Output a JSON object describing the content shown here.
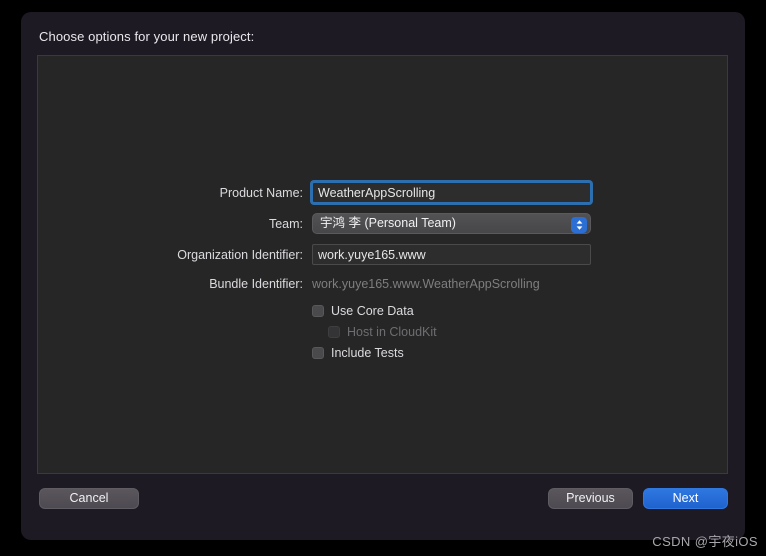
{
  "dialog": {
    "title": "Choose options for your new project:"
  },
  "form": {
    "rows": [
      {
        "label": "Product Name:",
        "value": "WeatherAppScrolling",
        "placeholder": "Product Name",
        "type": "textfield",
        "focused": true
      },
      {
        "label": "Team:",
        "value": "宇鸿 李 (Personal Team)",
        "type": "popup",
        "stepper_icon": "up-down-chevron-icon"
      },
      {
        "label": "Organization Identifier:",
        "value": "work.yuye165.www",
        "placeholder": "Organization Identifier",
        "type": "textfield",
        "focused": false
      },
      {
        "label": "Bundle Identifier:",
        "value": "work.yuye165.www.WeatherAppScrolling",
        "type": "static"
      }
    ],
    "checkboxes": [
      {
        "label": "Use Core Data",
        "checked": false,
        "disabled": false
      },
      {
        "label": "Host in CloudKit",
        "checked": false,
        "disabled": true
      },
      {
        "label": "Include Tests",
        "checked": false,
        "disabled": false
      }
    ]
  },
  "footer": {
    "cancel_label": "Cancel",
    "previous_label": "Previous",
    "next_label": "Next"
  },
  "watermark": {
    "text": "CSDN @宇夜iOS"
  },
  "colors": {
    "accent": "#2b6ed4",
    "focus_ring": "#2f6ea8",
    "dialog_bg": "#1e1a24",
    "panel_bg": "#262626",
    "primary_button": "#1f62cf"
  }
}
